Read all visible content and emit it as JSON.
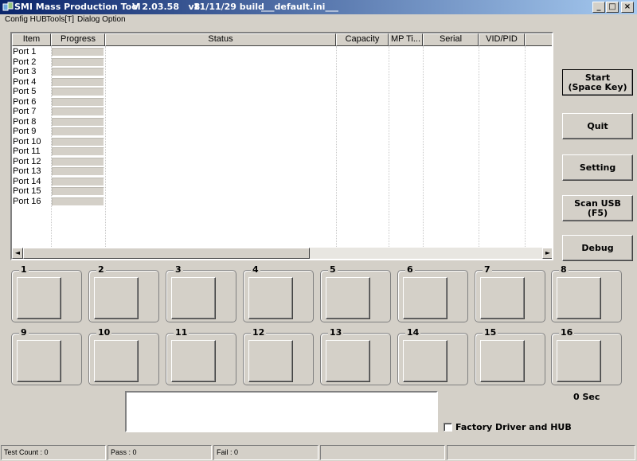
{
  "window": {
    "app_title": "SMI Mass Production Tool",
    "version": "V 2.03.58   v8",
    "build": "11/11/29 build",
    "ini_file": "___default.ini___",
    "min_glyph": "_",
    "max_glyph": "□",
    "close_glyph": "×"
  },
  "menu": {
    "items": [
      "Config HUB",
      "Tools[T]",
      "Dialog Option"
    ]
  },
  "table": {
    "columns": [
      "Item",
      "Progress",
      "Status",
      "Capacity",
      "MP Ti...",
      "Serial",
      "VID/PID"
    ],
    "rows": [
      "Port 1",
      "Port 2",
      "Port 3",
      "Port 4",
      "Port 5",
      "Port 6",
      "Port 7",
      "Port 8",
      "Port 9",
      "Port 10",
      "Port 11",
      "Port 12",
      "Port 13",
      "Port 14",
      "Port 15",
      "Port 16"
    ],
    "scroll_left": "◄",
    "scroll_right": "►"
  },
  "buttons": {
    "start": "Start\n(Space Key)",
    "quit": "Quit",
    "setting": "Setting",
    "scan_usb": "Scan USB\n(F5)",
    "debug": "Debug"
  },
  "ports": [
    "1",
    "2",
    "3",
    "4",
    "5",
    "6",
    "7",
    "8",
    "9",
    "10",
    "11",
    "12",
    "13",
    "14",
    "15",
    "16"
  ],
  "bottom": {
    "timer": "0 Sec",
    "factory_label": "Factory Driver and HUB"
  },
  "status": {
    "test_count": "Test Count : 0",
    "pass": "Pass : 0",
    "fail": "Fail : 0"
  }
}
